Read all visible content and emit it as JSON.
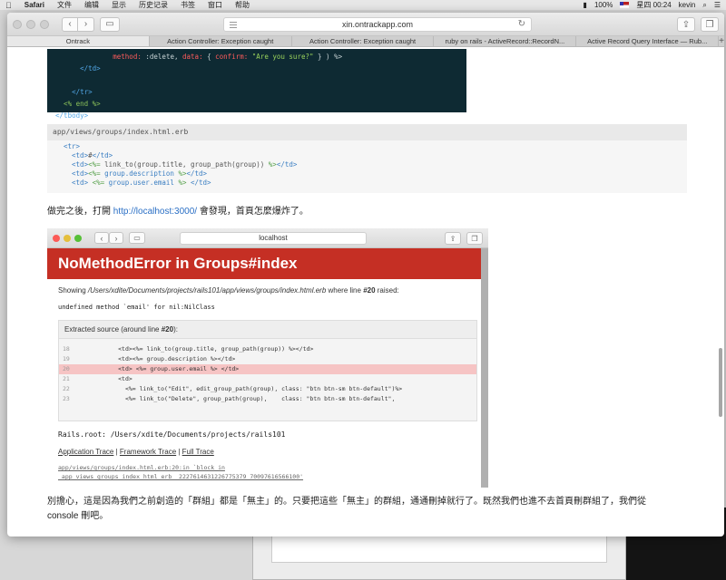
{
  "menubar": {
    "apple": "",
    "app": "Safari",
    "items": [
      "文件",
      "编辑",
      "显示",
      "历史记录",
      "书签",
      "窗口",
      "帮助"
    ],
    "battery": "100%",
    "clock": "星四 00:24",
    "user": "kevin"
  },
  "browser": {
    "url": "xin.ontrackapp.com",
    "tabs": [
      "Ontrack",
      "Action Controller: Exception caught",
      "Action Controller: Exception caught",
      "ruby on rails - ActiveRecord::RecordN...",
      "Active Record Query Interface — Rub..."
    ],
    "active_tab": 0,
    "new_tab": "+"
  },
  "dark_code": {
    "lines": [
      {
        "prefix": "                ",
        "kw": "method:",
        "mid": " :delete, ",
        "kw2": "data:",
        "mid2": " { ",
        "kw3": "confirm:",
        "str": " \"Are you sure?\"",
        "tail": " } ) %>"
      },
      {
        "text": "        </td>"
      },
      {
        "text": ""
      },
      {
        "text": "      </tr>"
      },
      {
        "text": "    <% end %>"
      },
      {
        "text": "  </tbody>"
      }
    ]
  },
  "file_header": "app/views/groups/index.html.erb",
  "light_code": {
    "l1": "<tr>",
    "l2a": "  <td>",
    "l2b": "#",
    "l2c": "</td>",
    "l3a": "  <td>",
    "l3b": "<%=",
    "l3c": " link_to(group.title, group_path(group)) ",
    "l3d": "%>",
    "l3e": "</td>",
    "l4a": "  <td>",
    "l4b": "<%=",
    "l4c": " group.description ",
    "l4d": "%>",
    "l4e": "</td>",
    "l5a": "  <td> ",
    "l5b": "<%=",
    "l5c": " group.user.email ",
    "l5d": "%>",
    "l5e": " </td>"
  },
  "para1": {
    "before": "做完之後，打開 ",
    "link": "http://localhost:3000/",
    "after": " 會發現，首頁怎麼爆炸了。"
  },
  "screenshot": {
    "url": "localhost",
    "error_title": "NoMethodError in Groups#index",
    "showing_prefix": "Showing ",
    "showing_path": "/Users/xdite/Documents/projects/rails101/app/views/groups/index.html.erb",
    "showing_mid": " where line ",
    "showing_line": "#20",
    "showing_suffix": " raised:",
    "message": "undefined method `email' for nil:NilClass",
    "extract_prefix": "Extracted source (around line ",
    "extract_line": "#20",
    "extract_suffix": "):",
    "source": [
      {
        "n": "18",
        "code": "          <td><%= link_to(group.title, group_path(group)) %></td>"
      },
      {
        "n": "19",
        "code": "          <td><%= group.description %></td>"
      },
      {
        "n": "20",
        "code": "          <td> <%= group.user.email %> </td>"
      },
      {
        "n": "21",
        "code": "          <td>"
      },
      {
        "n": "22",
        "code": "            <%= link_to(\"Edit\", edit_group_path(group), class: \"btn btn-sm btn-default\")%>"
      },
      {
        "n": "23",
        "code": "            <%= link_to(\"Delete\", group_path(group),    class: \"btn btn-sm btn-default\","
      }
    ],
    "highlight_index": 2,
    "rails_root": "Rails.root: /Users/xdite/Documents/projects/rails101",
    "trace_app": "Application Trace",
    "trace_framework": "Framework Trace",
    "trace_full": "Full Trace",
    "trace_sep": " | ",
    "trace_line1": "app/views/groups/index.html.erb:20:in `block in",
    "trace_line2": "_app_views_groups_index_html_erb__2227614631226775379_70097616566100'"
  },
  "para2": {
    "line1": "別擔心，這是因為我們之前創造的「群組」都是「無主」的。只要把這些「無主」的群組，通通刪掉就行了。既然我們也進不去首頁刪群組了，我們從",
    "line2": "console 刪吧。"
  }
}
